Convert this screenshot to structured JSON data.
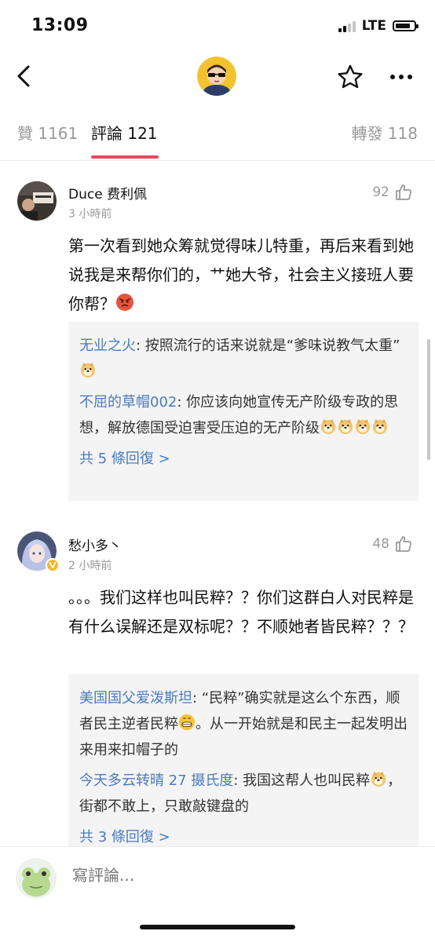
{
  "status_bar": {
    "time": "13:09",
    "network": "LTE",
    "battery_level": 0.8
  },
  "nav": {
    "back_icon": "chevron-left-icon",
    "star_icon": "star-outline-icon",
    "more_icon": "more-dots-icon"
  },
  "tabs": [
    {
      "label": "贊 1161",
      "active": false
    },
    {
      "label": "評論 121",
      "active": true
    },
    {
      "label": "轉發 118",
      "active": false
    }
  ],
  "comments": [
    {
      "name": "Duce 费利佩",
      "time": "3 小時前",
      "likes": "92",
      "text": "第一次看到她众筹就觉得味儿特重，再后来看到她说我是来帮你们的，艹她大爷，社会主义接班人要你帮？",
      "text_emoji": "angry-face-emoji",
      "replies": [
        {
          "name": "无业之火",
          "text": "按照流行的话来说就是“爹味说教气太重”",
          "emoji_count": 1
        },
        {
          "name": "不屈的草帽002",
          "text": "你应该向她宣传无产阶级专政的思想，解放德国受迫害受压迫的无产阶级",
          "emoji_count": 4
        }
      ],
      "more_replies": "共 5 條回復 >"
    },
    {
      "name": "愁小多丶",
      "time": "2 小時前",
      "likes": "48",
      "verified": true,
      "text": "。。。我们这样也叫民粹？？你们这群白人对民粹是有什么误解还是双标呢？？不顺她者皆民粹？？？",
      "replies": [
        {
          "name": "美国国父爱泼斯坦",
          "text_before": "“民粹”确实就是这么个东西，顺者民主逆者民粹",
          "text_after": "。从一开始就是和民主一起发明出来用来扣帽子的"
        },
        {
          "name": "今天多云转晴 27 摄氏度",
          "text_before": "我国这帮人也叫民粹",
          "text_after": "，街都不敢上，只敢敲键盘的"
        }
      ],
      "more_replies": "共 3 條回復 >"
    }
  ],
  "bottom_bar": {
    "placeholder": "寫評論..."
  }
}
